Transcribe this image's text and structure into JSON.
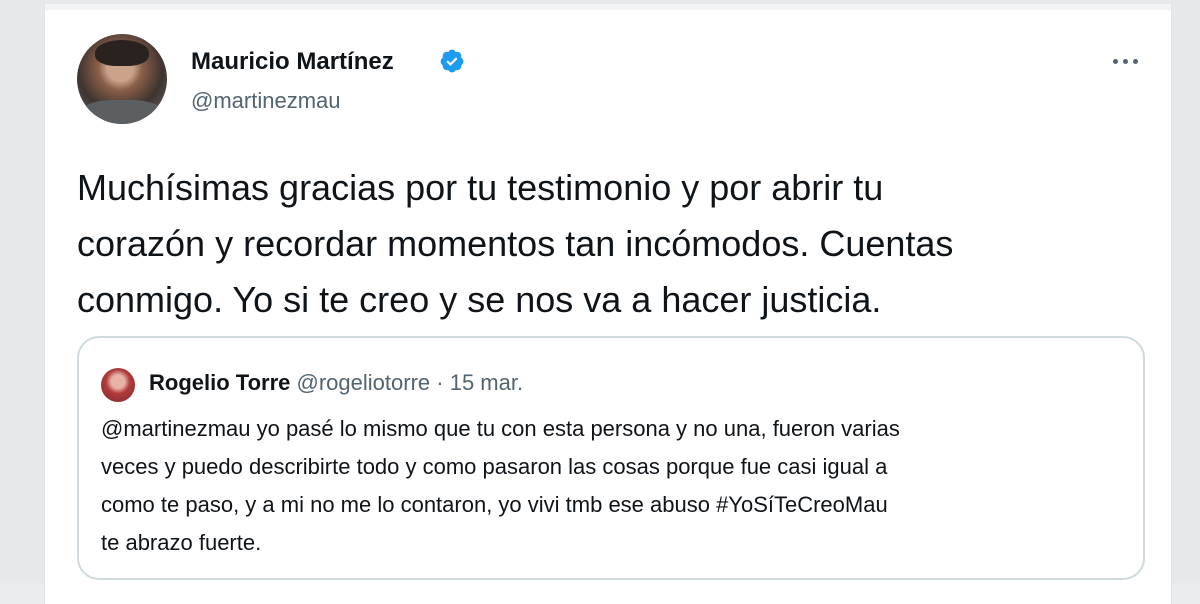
{
  "tweet": {
    "author_name": "Mauricio Martínez",
    "author_handle": "@martinezmau",
    "verified": true,
    "avatar_icon": "profile-photo",
    "more_icon": "ellipsis-icon",
    "text_lines": [
      "Muchísimas gracias por tu testimonio y por abrir tu",
      "corazón y recordar momentos tan incómodos. Cuentas",
      "conmigo. Yo si te creo y se nos va a hacer justicia."
    ]
  },
  "quoted_tweet": {
    "author_name": "Rogelio Torre",
    "author_handle": "@rogeliotorre",
    "separator": "·",
    "date": "15 mar.",
    "text_lines": [
      "@martinezmau yo pasé lo mismo que tu con esta persona y no una, fueron varias",
      "veces y puedo describirte todo y como pasaron las cosas porque fue casi igual a",
      "como te paso, y a mi no me lo contaron, yo vivi tmb ese abuso #YoSíTeCreoMau",
      "te abrazo fuerte."
    ]
  },
  "colors": {
    "verified_badge": "#1d9bf0",
    "primary_text": "#0f1419",
    "secondary_text": "#536471",
    "border": "#cfd9de"
  }
}
